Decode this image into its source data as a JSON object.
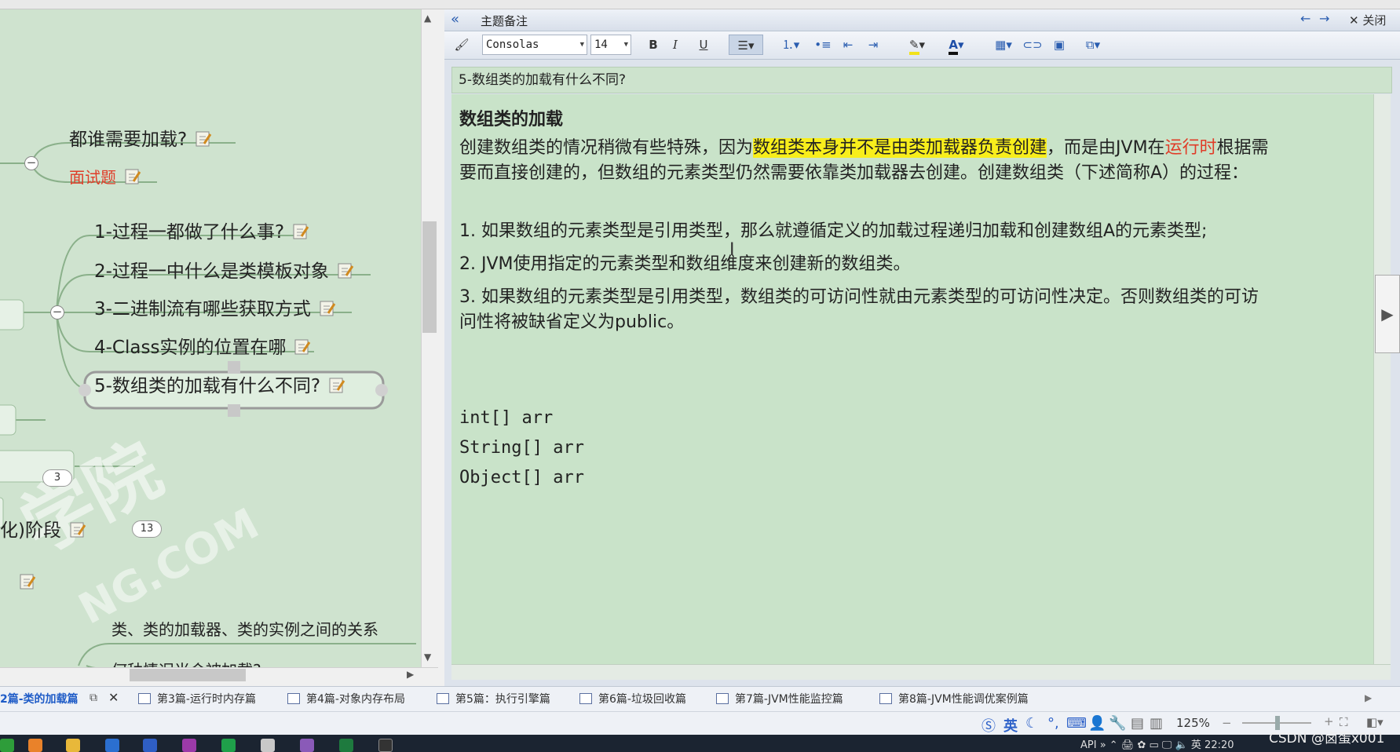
{
  "mindmap": {
    "topics": {
      "t0": "都谁需要加载?",
      "t1": "面试题",
      "t2": "1-过程一都做了什么事?",
      "t3": "2-过程一中什么是类模板对象",
      "t4": "3-二进制流有哪些获取方式",
      "t5": "4-Class实例的位置在哪",
      "t6": "5-数组类的加载有什么不同?",
      "t7": "化)阶段",
      "t8": "类、类的加载器、类的实例之间的关系",
      "t9": "何种情况当会被加载?"
    },
    "badges": {
      "b1": "3",
      "b2": "13"
    },
    "collapse_symbol": "−",
    "watermark": "学院",
    "watermark2": "NG.COM"
  },
  "panel": {
    "title": "主题备注",
    "back_icon": "«",
    "close_label": "关闭",
    "prev_icon": "←",
    "next_icon": "→"
  },
  "toolbar": {
    "font_family": "Consolas",
    "font_size": "14",
    "bold": "B",
    "italic": "I",
    "underline": "U"
  },
  "note": {
    "subject": "5-数组类的加载有什么不同?",
    "heading": "数组类的加载",
    "p1_a": "创建数组类的情况稍微有些特殊，因为",
    "p1_hl": "数组类本身并不是由类加载器负责创建",
    "p1_b": "，而是由JVM在",
    "p1_red": "运行时",
    "p1_c": "根据需",
    "p1_line2": "要而直接创建的，但数组的元素类型仍然需要依靠类加载器去创建。创建数组类（下述简称A）的过程：",
    "i1": "1. 如果数组的元素类型是引用类型，那么就遵循定义的加载过程递归加载和创建数组A的元素类型;",
    "i2": "2. JVM使用指定的元素类型和数组维度来创建新的数组类。",
    "i3_a": "3. 如果数组的元素类型是引用类型，数组类的可访问性就由元素类型的可访问性决定。否则数组类的可访",
    "i3_b": "问性将被缺省定义为public。",
    "code1": "int[] arr",
    "code2": "String[] arr",
    "code3": "Object[] arr"
  },
  "tabs": [
    "2篇-类的加载篇",
    "第3篇-运行时内存篇",
    "第4篇-对象内存布局",
    "第5篇：执行引擎篇",
    "第6篇-垃圾回收篇",
    "第7篇-JVM性能监控篇",
    "第8篇-JVM性能调优案例篇"
  ],
  "status": {
    "ime": "英",
    "zoom": "125%"
  },
  "taskbar": {
    "tray_text": "API",
    "lang": "英",
    "time": "22:20"
  },
  "credit": "CSDN @卤蛋x001",
  "colors": {
    "mindmap_bg": "#cfe3cf",
    "note_bg": "#c9e3c9",
    "highlight": "#f8ee1c",
    "red_text": "#e03c28",
    "active_tab": "#1f5cc7"
  }
}
